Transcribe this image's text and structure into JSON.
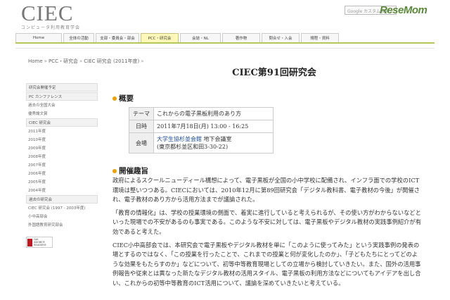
{
  "header": {
    "logo_text": "CIEC",
    "logo_subtitle": "コンピュータ利用教育学会",
    "search_placeholder": "Google カスタム検索",
    "brand": "ReseMom"
  },
  "nav": [
    {
      "label": "Home",
      "active": false
    },
    {
      "label": "全体の活動",
      "active": false
    },
    {
      "label": "支部・委員会・部会",
      "active": false
    },
    {
      "label": "PCC・研究会",
      "active": true
    },
    {
      "label": "会誌・NL",
      "active": false
    },
    {
      "label": "著作物",
      "active": false
    },
    {
      "label": "問合せ・入会",
      "active": false
    },
    {
      "label": "規程・資料",
      "active": false
    }
  ],
  "breadcrumb": [
    "Home",
    "PCC・研究会",
    "CIEC 研究会 (2011年度)"
  ],
  "sidebar": [
    {
      "text": "研究会開催予定",
      "head": true
    },
    {
      "text": "PC カンファレンス",
      "head": true
    },
    {
      "text": "過去の全国大会",
      "head": false
    },
    {
      "text": "優秀論文賞",
      "head": false
    },
    {
      "text": "CIEC 研究会",
      "head": true
    },
    {
      "text": "2011年度",
      "head": false
    },
    {
      "text": "2010年度",
      "head": false
    },
    {
      "text": "2009年度",
      "head": false
    },
    {
      "text": "2008年度",
      "head": false
    },
    {
      "text": "2007年度",
      "head": false
    },
    {
      "text": "2006年度",
      "head": false
    },
    {
      "text": "2005年度",
      "head": false
    },
    {
      "text": "2004年度",
      "head": false
    },
    {
      "text": "過去の研究会",
      "head": true
    },
    {
      "text": "CIEC 研究会 (1997 - 2003年度)",
      "head": false
    },
    {
      "text": "小中高部会",
      "head": false
    },
    {
      "text": "外国語教育研究部会",
      "head": false
    }
  ],
  "sidebar_banner": {
    "line1": "Get",
    "line2": "ADOBE® READER®"
  },
  "main": {
    "title": "CIEC第91回研究会",
    "overview_heading": "概要",
    "info": [
      {
        "key": "テーマ",
        "value": "これからの電子黒板利用のあり方",
        "link": "",
        "extra": ""
      },
      {
        "key": "日時",
        "value": "2011年7月18日(月) 13:00 - 16:25",
        "link": "",
        "extra": ""
      },
      {
        "key": "会場",
        "value": "",
        "link": "大学生協杉並会館",
        "extra": " 地下会議室",
        "value2": "(東京都杉並区和田3-30-22)"
      }
    ],
    "purpose_heading": "開催趣旨",
    "paragraphs": [
      "政府によるスクールニューディール構想によって、電子黒板が全国の小中学校に配備され、インフラ面での学校のICT環境は整いつつある。CIECにおいては、2010年12月に第89回研究会「デジタル教科書、電子教材の今後」が開催され、電子教材のあり方から活用方法までが議論された。",
      "「教育の情報化」は、学校の授業環境の側面で、着実に進行していると考えられるが、その使い方がわからないなどといった現場での不安があるのも事実である。このような不安に対しては、電子黒板やデジタル教材の実践事例紹介が有効であると考えた。",
      "CIEC小中高部会では、本研究会で電子黒板やデジタル教材を単に「このように使ってみた」という実践事例の発表の場とするのではなく、「この授業を行ったことで、これまでの授業と何が変化したのか」、「子どもたちにとってどのような効果をもたらすのか」などについて、初等中等教育現場としての立場から検討していきたい。また、国外の活用事例報告や従来とは異なった新たなデジタル教材の活用スタイル、電子黒板の利用方法などについてもアイデアを出し合い、これからの初等中等教育のICT活用について、議論を深めていきたいと考えている。"
    ]
  },
  "colors": {
    "accent": "#b5c95a",
    "bullet": "#f0a000",
    "nav_active": "#fff8b8",
    "link": "#1a4a9a"
  }
}
